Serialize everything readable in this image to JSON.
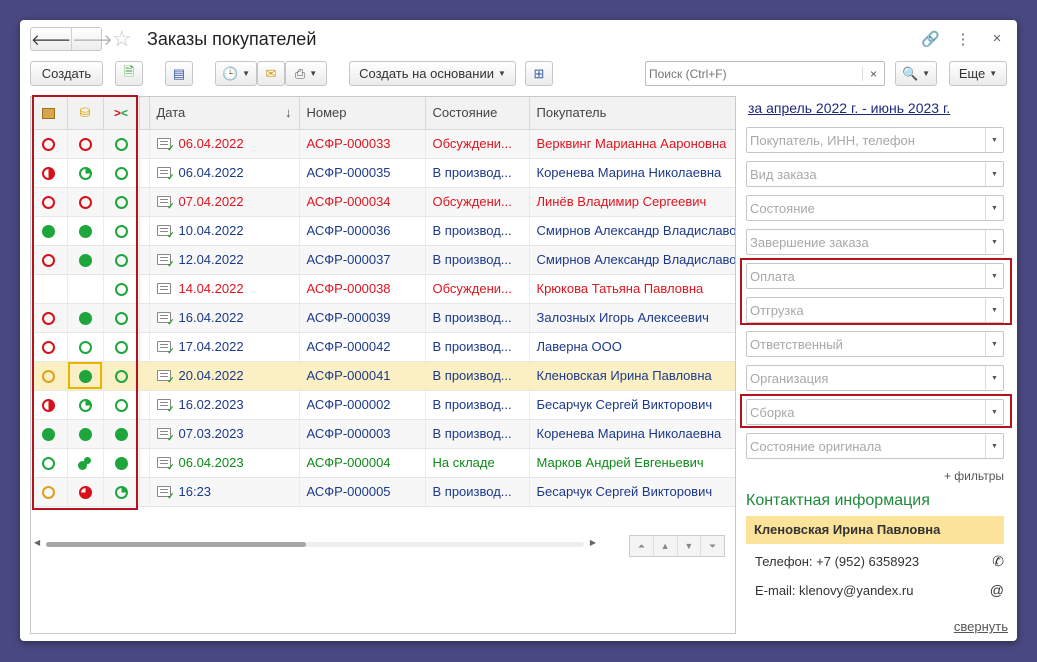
{
  "window": {
    "title": "Заказы покупателей"
  },
  "toolbar": {
    "create_label": "Создать",
    "create_based_label": "Создать на основании",
    "more_label": "Еще",
    "search_placeholder": "Поиск (Ctrl+F)",
    "search_clear": "×"
  },
  "table": {
    "columns": [
      "Дата",
      "Номер",
      "Состояние",
      "Покупатель"
    ],
    "sort_indicator": "↓",
    "rows": [
      {
        "date": "06.04.2022",
        "number": "АСФР-000033",
        "state": "Обсуждени...",
        "customer": "Верквинг Марианна Аароновна",
        "color": "red",
        "posted": true
      },
      {
        "date": "06.04.2022",
        "number": "АСФР-000035",
        "state": "В производ...",
        "customer": "Коренева Марина Николаевна",
        "color": "blue",
        "posted": true
      },
      {
        "date": "07.04.2022",
        "number": "АСФР-000034",
        "state": "Обсуждени...",
        "customer": "Линёв Владимир Сергеевич",
        "color": "red",
        "posted": true
      },
      {
        "date": "10.04.2022",
        "number": "АСФР-000036",
        "state": "В производ...",
        "customer": "Смирнов Александр Владиславо",
        "color": "blue",
        "posted": true
      },
      {
        "date": "12.04.2022",
        "number": "АСФР-000037",
        "state": "В производ...",
        "customer": "Смирнов Александр Владиславо",
        "color": "blue",
        "posted": true
      },
      {
        "date": "14.04.2022",
        "number": "АСФР-000038",
        "state": "Обсуждени...",
        "customer": "Крюкова Татьяна Павловна",
        "color": "red",
        "posted": false
      },
      {
        "date": "16.04.2022",
        "number": "АСФР-000039",
        "state": "В производ...",
        "customer": "Залозных Игорь Алексеевич",
        "color": "blue",
        "posted": true
      },
      {
        "date": "17.04.2022",
        "number": "АСФР-000042",
        "state": "В производ...",
        "customer": "Лаверна ООО",
        "color": "blue",
        "posted": true
      },
      {
        "date": "20.04.2022",
        "number": "АСФР-000041",
        "state": "В производ...",
        "customer": "Кленовская Ирина Павловна",
        "color": "blue",
        "posted": true
      },
      {
        "date": "16.02.2023",
        "number": "АСФР-000002",
        "state": "В производ...",
        "customer": "Бесарчук Сергей Викторович",
        "color": "blue",
        "posted": true
      },
      {
        "date": "07.03.2023",
        "number": "АСФР-000003",
        "state": "В производ...",
        "customer": "Коренева Марина Николаевна",
        "color": "blue",
        "posted": true
      },
      {
        "date": "06.04.2023",
        "number": "АСФР-000004",
        "state": "На складе",
        "customer": "Марков Андрей Евгеньевич",
        "color": "green",
        "posted": true
      },
      {
        "date": "16:23",
        "number": "АСФР-000005",
        "state": "В производ...",
        "customer": "Бесарчук Сергей Викторович",
        "color": "blue",
        "posted": true
      }
    ],
    "status_icons": [
      [
        "empty-red",
        "empty-red",
        "empty-green"
      ],
      [
        "half-red",
        "quarter-green",
        "empty-green"
      ],
      [
        "empty-red",
        "empty-red",
        "empty-green"
      ],
      [
        "full-green",
        "full-green",
        "empty-green"
      ],
      [
        "empty-red",
        "full-green",
        "empty-green"
      ],
      [
        "none",
        "none",
        "empty-green"
      ],
      [
        "empty-red",
        "full-green",
        "empty-green"
      ],
      [
        "empty-red",
        "empty-green",
        "empty-green"
      ],
      [
        "empty-orange",
        "full-green",
        "empty-green"
      ],
      [
        "half-red",
        "quarter-green",
        "empty-green"
      ],
      [
        "full-green",
        "full-green",
        "full-green"
      ],
      [
        "empty-green",
        "part-green",
        "full-green"
      ],
      [
        "empty-orange",
        "threeq-red",
        "quarter-green"
      ]
    ],
    "selected_row": 8
  },
  "filters": {
    "period": "за апрель 2022 г. - июнь 2023 г.",
    "items": [
      "Покупатель, ИНН, телефон",
      "Вид заказа",
      "Состояние",
      "Завершение заказа",
      "Оплата",
      "Отгрузка",
      "Ответственный",
      "Организация",
      "Сборка",
      "Состояние оригинала"
    ],
    "more": "+ фильтры"
  },
  "contact": {
    "title": "Контактная информация",
    "name": "Кленовская Ирина Павловна",
    "phone": "Телефон: +7 (952) 6358923",
    "email": "E-mail: klenovy@yandex.ru",
    "collapse": "свернуть"
  },
  "colors": {
    "red": "#e0141e",
    "blue": "#1d3a8a",
    "green": "#0e8a1a",
    "highlight_frame": "#b3141d",
    "selected_row": "#fbefc4"
  }
}
